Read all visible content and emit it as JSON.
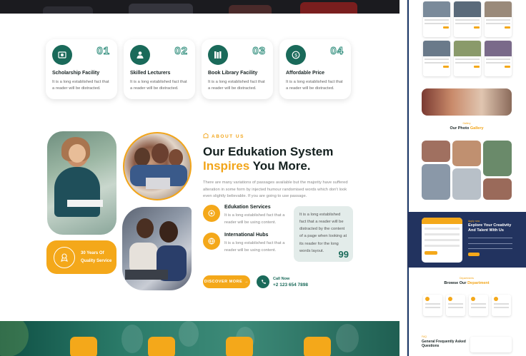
{
  "features": [
    {
      "num": "01",
      "title": "Scholarship Facility",
      "desc": "It is a long established fact that a reader will be distracted.",
      "icon": "scholarship-icon"
    },
    {
      "num": "02",
      "title": "Skilled Lecturers",
      "desc": "It is a long established fact that a reader will be distracted.",
      "icon": "lecturer-icon"
    },
    {
      "num": "03",
      "title": "Book Library Facility",
      "desc": "It is a long established fact that a reader will be distracted.",
      "icon": "library-icon"
    },
    {
      "num": "04",
      "title": "Affordable Price",
      "desc": "It is a long established fact that a reader will be distracted.",
      "icon": "price-icon"
    }
  ],
  "experience_badge": {
    "line1": "30 Years Of",
    "line2": "Quality Service"
  },
  "about": {
    "tagline": "ABOUT US",
    "heading_line1": "Our Edukation System",
    "heading_hl": "Inspires",
    "heading_rest": " You More.",
    "paragraph": "There are many variations of passages available but the majority have suffered alteration in some form by injected humour randomised words which don't look even slightly believable. If you are going to use passage."
  },
  "services": [
    {
      "title": "Edukation Services",
      "desc": "It is a long established fact that a reader will be using content."
    },
    {
      "title": "International Hubs",
      "desc": "It is a long established fact that a reader will be using content."
    }
  ],
  "quote": {
    "text": "It is a long established fact that a reader will be distracted by the content of a page when looking at its reader for the long words layout.",
    "mark": "99"
  },
  "cta": {
    "discover": "DISCOVER MORE",
    "call_label": "Call Now",
    "call_number": "+2 123 654 7898"
  },
  "sidebar": {
    "gallery_tag": "Gallery",
    "gallery_title_a": "Our Photo ",
    "gallery_title_b": "Gallery",
    "join_tag": "Apply now",
    "join_title": "Explore Your Creativity And Talent With Us",
    "dept_tag": "Departments",
    "dept_title_a": "Browse Our ",
    "dept_title_b": "Department",
    "faq_tag": "FAQ",
    "faq_title": "General Frequently Asked Questions"
  },
  "colors": {
    "accent": "#f4a81a",
    "primary": "#1a6a5a",
    "navy": "#22335f"
  }
}
